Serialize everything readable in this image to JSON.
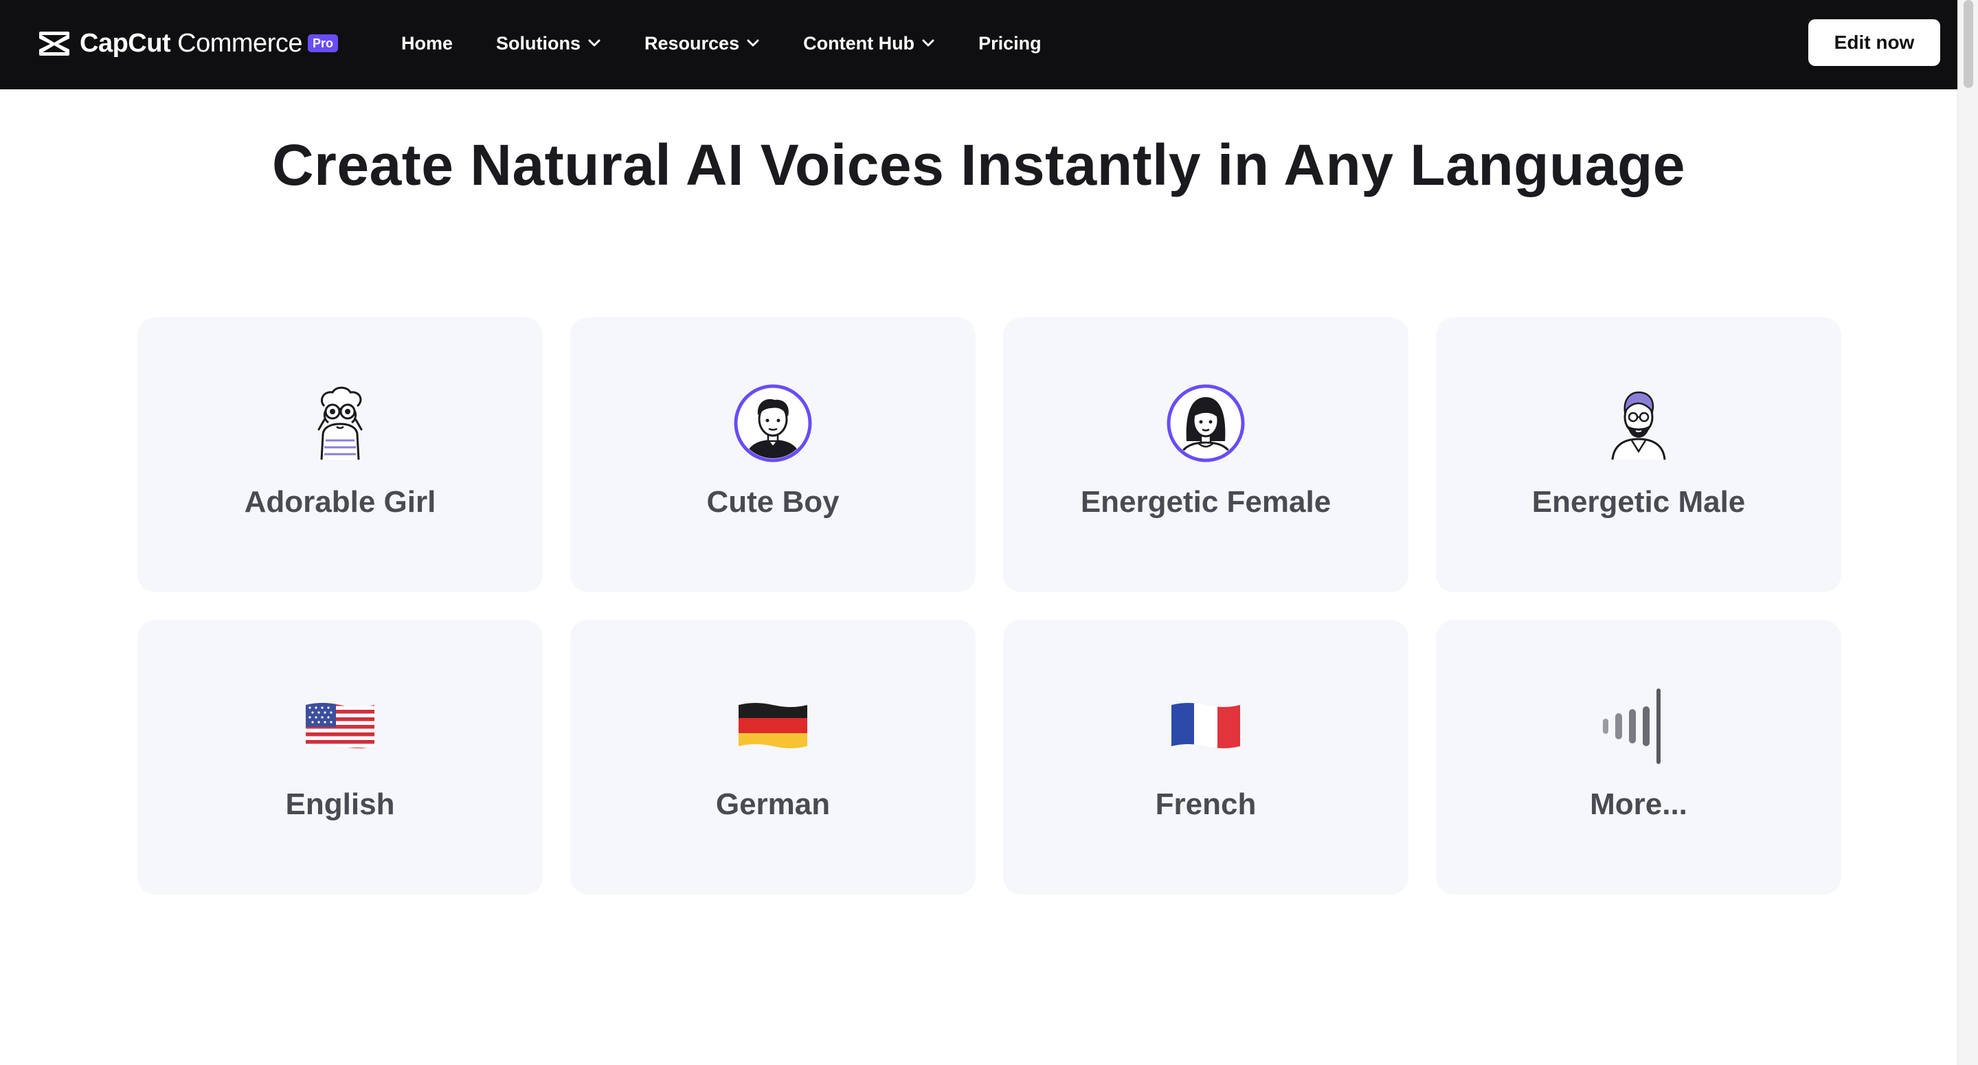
{
  "nav": {
    "logo_brand": "CapCut",
    "logo_product": "Commerce",
    "logo_badge": "Pro",
    "links": [
      {
        "label": "Home"
      },
      {
        "label": "Solutions"
      },
      {
        "label": "Resources"
      },
      {
        "label": "Content Hub"
      },
      {
        "label": "Pricing"
      }
    ],
    "cta_label": "Edit now"
  },
  "main": {
    "title": "Create Natural AI Voices Instantly in Any Language",
    "voices": [
      {
        "label": "Adorable Girl",
        "icon": "girl-binoculars-icon"
      },
      {
        "label": "Cute Boy",
        "icon": "boy-avatar-icon"
      },
      {
        "label": "Energetic Female",
        "icon": "female-avatar-icon"
      },
      {
        "label": "Energetic Male",
        "icon": "male-avatar-icon"
      }
    ],
    "languages": [
      {
        "label": "English",
        "icon": "us-flag-icon"
      },
      {
        "label": "German",
        "icon": "german-flag-icon"
      },
      {
        "label": "French",
        "icon": "french-flag-icon"
      },
      {
        "label": "More...",
        "icon": "sound-wave-icon"
      }
    ]
  },
  "colors": {
    "nav_background": "#0f0f11",
    "accent": "#6a4cf5",
    "card_background": "#f6f7fb",
    "card_text": "#4a4a52"
  }
}
